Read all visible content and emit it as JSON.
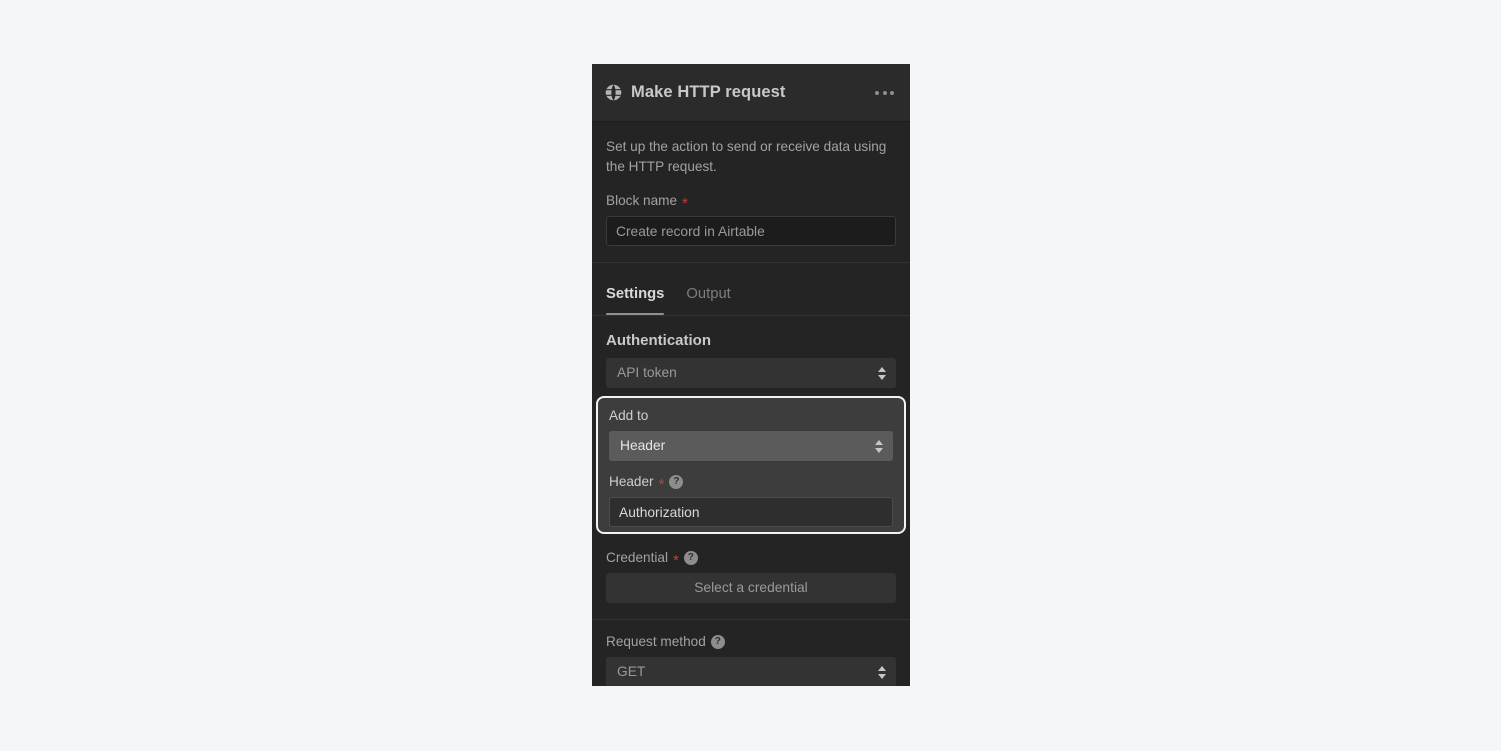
{
  "window": {
    "background_color": "#f4f6f8"
  },
  "panel": {
    "header": {
      "icon": "globe-icon",
      "title": "Make HTTP request",
      "menu_icon": "kebab-menu-icon"
    },
    "description": "Set up the action to send or receive data using the HTTP request.",
    "block_name": {
      "label": "Block name",
      "required_marker": "*",
      "value": "Create record in Airtable"
    },
    "tabs": [
      {
        "label": "Settings",
        "active": true
      },
      {
        "label": "Output",
        "active": false
      }
    ],
    "settings": {
      "authentication": {
        "heading": "Authentication",
        "select_value": "API token"
      },
      "highlighted": {
        "add_to": {
          "label": "Add to",
          "select_value": "Header"
        },
        "header": {
          "label": "Header",
          "required_marker": "*",
          "help_icon": "help-icon",
          "value": "Authorization"
        }
      },
      "credential": {
        "label": "Credential",
        "required_marker": "*",
        "help_icon": "help-icon",
        "button_label": "Select a credential"
      },
      "request_method": {
        "label": "Request method",
        "help_icon": "help-icon",
        "select_value": "GET"
      }
    }
  },
  "colors": {
    "panel_bg": "#242424",
    "header_bg": "#2b2b2b",
    "highlight_border": "#f2f2f2",
    "required_star": "#cc3b30",
    "select_light_bg": "#5b5b5b"
  }
}
